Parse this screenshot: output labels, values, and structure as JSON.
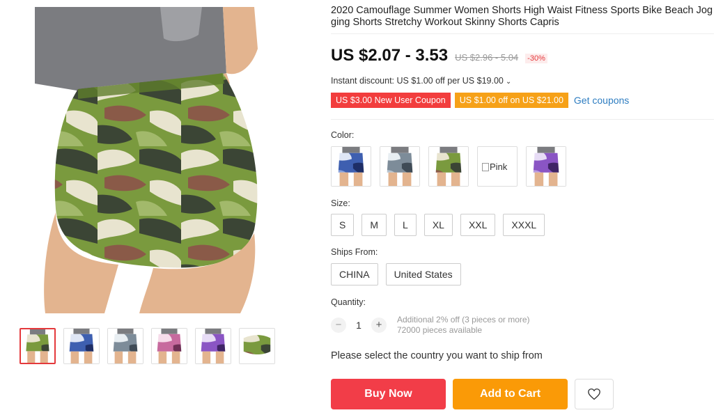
{
  "product": {
    "title": "2020 Camouflage Summer Women Shorts High Waist Fitness Sports Bike Beach Jogging Shorts Stretchy Workout Skinny Shorts Capris",
    "price": "US $2.07 - 3.53",
    "original_price": "US $2.96 - 5.04",
    "discount": "-30%"
  },
  "promo": {
    "instant_discount": "Instant discount: US $1.00 off per US $19.00",
    "coupons": [
      "US $3.00 New User Coupon",
      "US $1.00 off on US $21.00"
    ],
    "get_coupons": "Get coupons"
  },
  "gallery": {
    "main_colorway": "green-camo",
    "thumbnails": [
      "green-camo",
      "blue-camo",
      "gray-camo",
      "pink-camo",
      "purple-camo",
      "green-camo-flat"
    ]
  },
  "color": {
    "label": "Color:",
    "options": [
      "blue-camo",
      "gray-camo",
      "green-camo",
      "Pink",
      "purple-camo"
    ]
  },
  "size": {
    "label": "Size:",
    "options": [
      "S",
      "M",
      "L",
      "XL",
      "XXL",
      "XXXL"
    ]
  },
  "ships_from": {
    "label": "Ships From:",
    "options": [
      "CHINA",
      "United States"
    ]
  },
  "quantity": {
    "label": "Quantity:",
    "value": "1",
    "extra_discount": "Additional 2% off (3 pieces or more)",
    "available": "72000 pieces available"
  },
  "ship_message": "Please select the country you want to ship from",
  "actions": {
    "buy_now": "Buy Now",
    "add_to_cart": "Add to Cart",
    "wishlist_icon": "heart-icon"
  },
  "colors": {
    "price_red": "#f23d48",
    "cart_orange": "#fa9a07",
    "link_blue": "#2e7dc1",
    "active_border": "#e4393c"
  }
}
